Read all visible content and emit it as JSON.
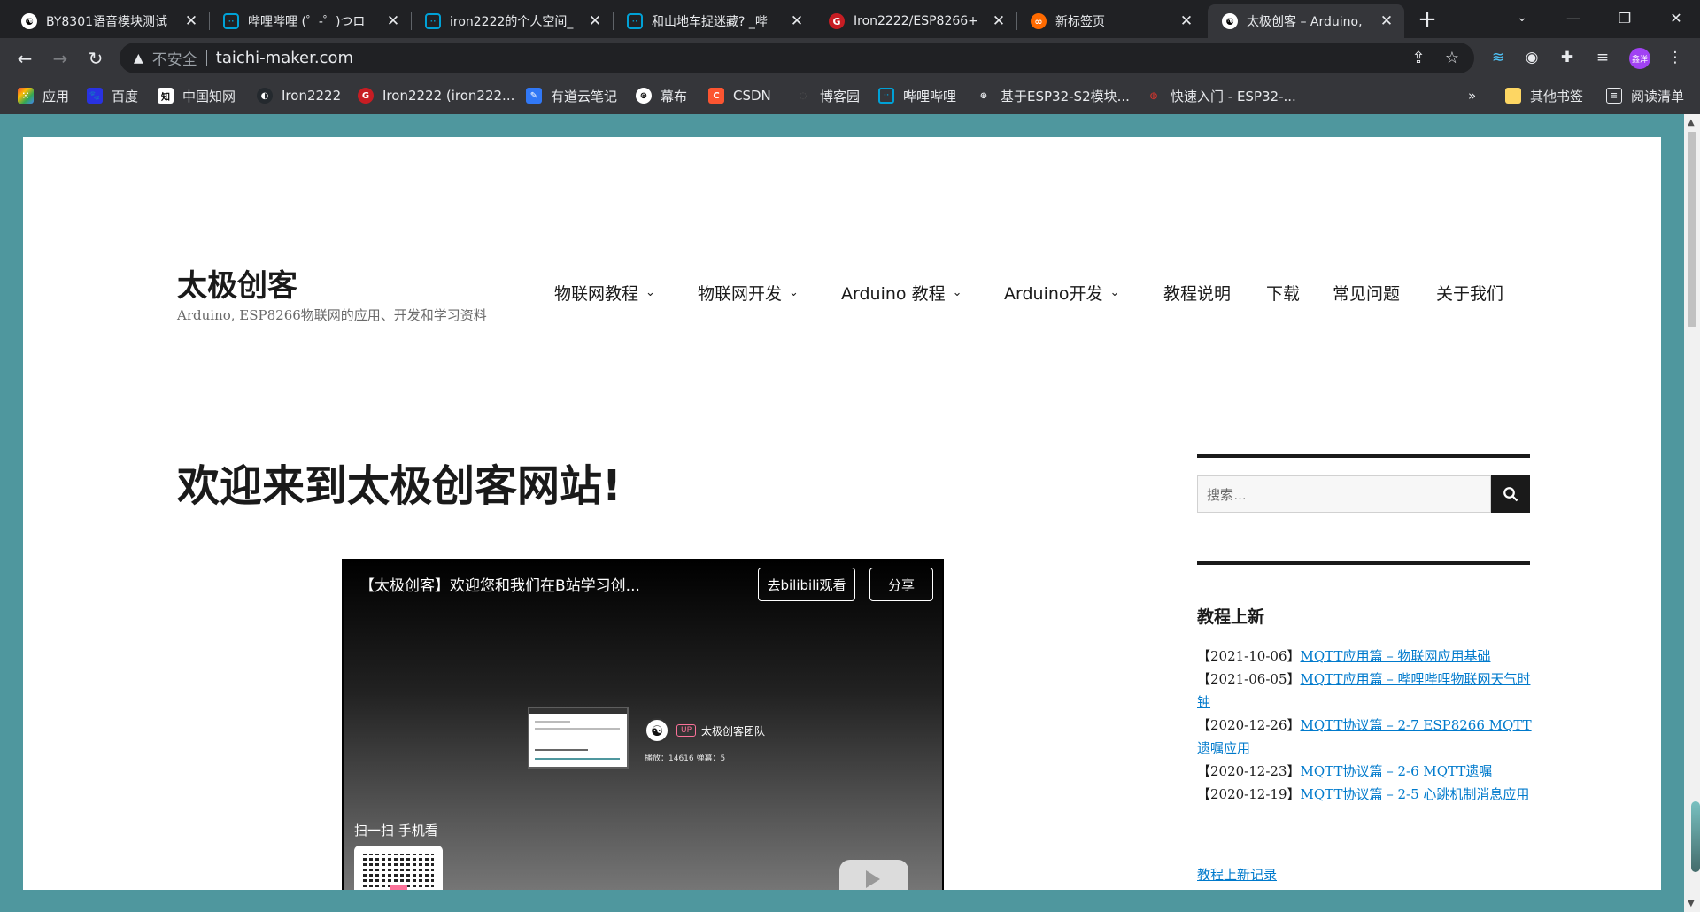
{
  "colors": {
    "tabstrip_bg": "#202124",
    "toolbar_bg": "#35363a",
    "viewport_bg": "#4f979e",
    "link": "#007acc",
    "bilibili_pink": "#fb7299"
  },
  "tabs": [
    {
      "title": "BY8301语音模块测试",
      "icon": "logo-icon",
      "active": false
    },
    {
      "title": "哔哩哔哩 (゜-゜)つロ",
      "icon": "bilibili-icon",
      "active": false
    },
    {
      "title": "iron2222的个人空间_",
      "icon": "bilibili-icon",
      "active": false
    },
    {
      "title": "和山地车捉迷藏? _哔",
      "icon": "bilibili-icon",
      "active": false
    },
    {
      "title": "Iron2222/ESP8266+",
      "icon": "gitee-icon",
      "active": false
    },
    {
      "title": "新标签页",
      "icon": "new-tab-page-icon",
      "active": false
    },
    {
      "title": "太极创客 – Arduino,",
      "icon": "taichi-icon",
      "active": true
    }
  ],
  "address_bar": {
    "security_label": "不安全",
    "url": "taichi-maker.com"
  },
  "profile": {
    "avatar_text": "鑫洋"
  },
  "bookmarks": [
    {
      "label": "应用",
      "icon": "apps-grid-icon"
    },
    {
      "label": "百度",
      "icon": "baidu-icon"
    },
    {
      "label": "中国知网",
      "icon": "cnki-icon"
    },
    {
      "label": "Iron2222",
      "icon": "github-icon"
    },
    {
      "label": "Iron2222 (iron222...",
      "icon": "gitee-icon"
    },
    {
      "label": "有道云笔记",
      "icon": "youdao-note-icon"
    },
    {
      "label": "幕布",
      "icon": "mubu-icon"
    },
    {
      "label": "CSDN",
      "icon": "csdn-icon"
    },
    {
      "label": "博客园",
      "icon": "cnblogs-icon"
    },
    {
      "label": "哔哩哔哩",
      "icon": "bilibili-icon"
    },
    {
      "label": "基于ESP32-S2模块...",
      "icon": "globe-icon"
    },
    {
      "label": "快速入门 - ESP32-...",
      "icon": "espressif-icon"
    }
  ],
  "bookmarks_right": {
    "overflow": "»",
    "other_bookmarks": "其他书签",
    "reading_list": "阅读清单"
  },
  "site": {
    "title": "太极创客",
    "description": "Arduino, ESP8266物联网的应用、开发和学习资料",
    "menu": [
      {
        "label": "物联网教程",
        "has_dropdown": true
      },
      {
        "label": "物联网开发",
        "has_dropdown": true
      },
      {
        "label": "Arduino 教程",
        "has_dropdown": true
      },
      {
        "label": "Arduino开发",
        "has_dropdown": true
      },
      {
        "label": "教程说明",
        "has_dropdown": false
      },
      {
        "label": "下载",
        "has_dropdown": false
      },
      {
        "label": "常见问题",
        "has_dropdown": false
      },
      {
        "label": "关于我们",
        "has_dropdown": false
      }
    ]
  },
  "main": {
    "heading": "欢迎来到太极创客网站!",
    "video": {
      "title": "【太极创客】欢迎您和我们在B站学习创...",
      "watch_button": "去bilibili观看",
      "share_button": "分享",
      "up_badge": "UP",
      "author": "太极创客团队",
      "stats": "播放：14616    弹幕：5",
      "scan_text": "扫一扫 手机看"
    }
  },
  "sidebar": {
    "search_placeholder": "搜索…",
    "widget_title": "教程上新",
    "posts": [
      {
        "date": "【2021-10-06】",
        "title": "MQTT应用篇 – 物联网应用基础"
      },
      {
        "date": "【2021-06-05】",
        "title": "MQTT应用篇 – 哔哩哔哩物联网天气时钟"
      },
      {
        "date": "【2020-12-26】",
        "title": "MQTT协议篇 – 2-7 ESP8266 MQTT遗嘱应用"
      },
      {
        "date": "【2020-12-23】",
        "title": "MQTT协议篇 – 2-6 MQTT遗嘱"
      },
      {
        "date": "【2020-12-19】",
        "title": "MQTT协议篇 – 2-5 心跳机制消息应用"
      }
    ],
    "more_link": "教程上新记录"
  }
}
